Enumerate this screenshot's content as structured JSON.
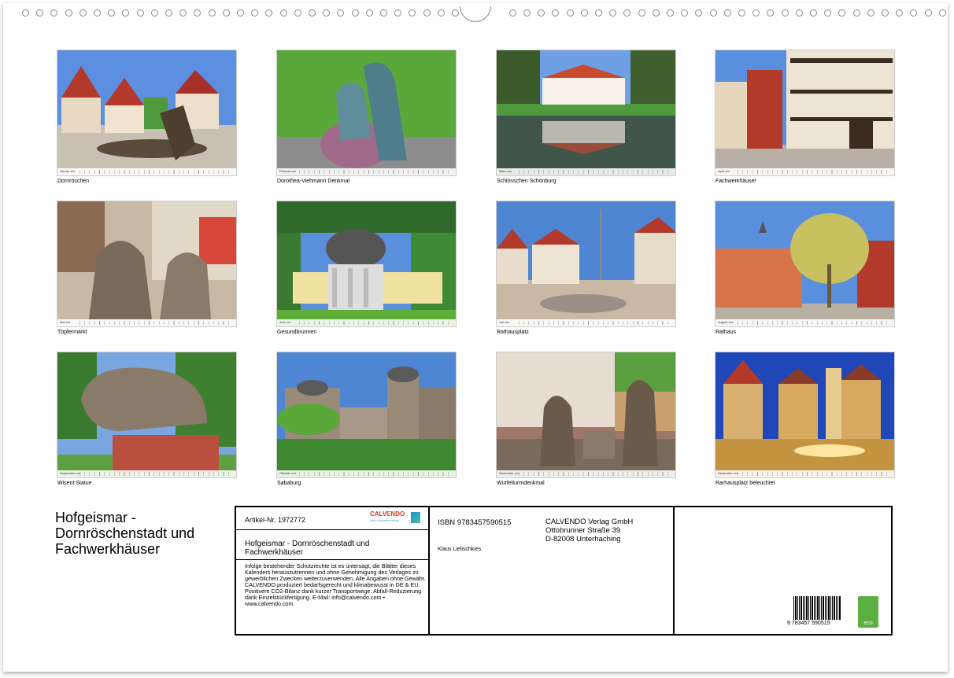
{
  "months": [
    {
      "strip": "Januar xxx",
      "caption": "Dornröschen"
    },
    {
      "strip": "Februar xxx",
      "caption": "Dorothea-Viehmann Denkmal"
    },
    {
      "strip": "März xxx",
      "caption": "Schlösschen  Schönburg"
    },
    {
      "strip": "April xxx",
      "caption": "Fachwerkhäuser"
    },
    {
      "strip": "Mai xxx",
      "caption": "Töpfermarkt"
    },
    {
      "strip": "Juni xxx",
      "caption": "Gesundbrunnen"
    },
    {
      "strip": "Juli xxx",
      "caption": "Rathausplatz"
    },
    {
      "strip": "August xxx",
      "caption": "Rathaus"
    },
    {
      "strip": "September xxx",
      "caption": "Wisent Statue"
    },
    {
      "strip": "Oktober xxx",
      "caption": "Sababurg"
    },
    {
      "strip": "November xxx",
      "caption": "Würfelturmdenkmal"
    },
    {
      "strip": "Dezember xxx",
      "caption": "Rarhausplatz beleuchtet"
    }
  ],
  "title": "Hofgeismar - Dornröschenstadt und Fachwerkhäuser",
  "info": {
    "article": "Artikel-Nr. 1972772",
    "calvendo_logo": "CALVENDO",
    "calvendo_tagline": "Mein Kalenderverlag",
    "inner_title": "Hofgeismar - Dornröschenstadt und Fachwerkhäuser",
    "legal": "Infolge bestehender Schutzrechte ist es untersagt, die Blätter dieses Kalenders herauszutrennen und ohne Genehmigung des Verlages zu gewerblichen Zwecken weiterzuverwenden. Alle Angaben ohne Gewähr. CALVENDO produziert bedarfsgerecht und klimabewusst in DE & EU. Positivere CO2-Bilanz dank kurzer Transportwege. Abfall-Reduzierung dank Einzelstückfertigung. E-Mail: info@calvendo.com • www.calvendo.com",
    "isbn": "ISBN 9783457590515",
    "author": "Klaus Lielischkies",
    "publisher_name": "CALVENDO Verlag GmbH",
    "publisher_street": "Ottobrunner Straße 39",
    "publisher_city": "D-82008 Unterhaching",
    "barcode_digits": "9  783457  590515",
    "eco_label": "eco"
  },
  "colors": {
    "frame": "#000000",
    "sky": "#4f86d4",
    "grass": "#5fae3a",
    "timber": "#b33a2a"
  }
}
